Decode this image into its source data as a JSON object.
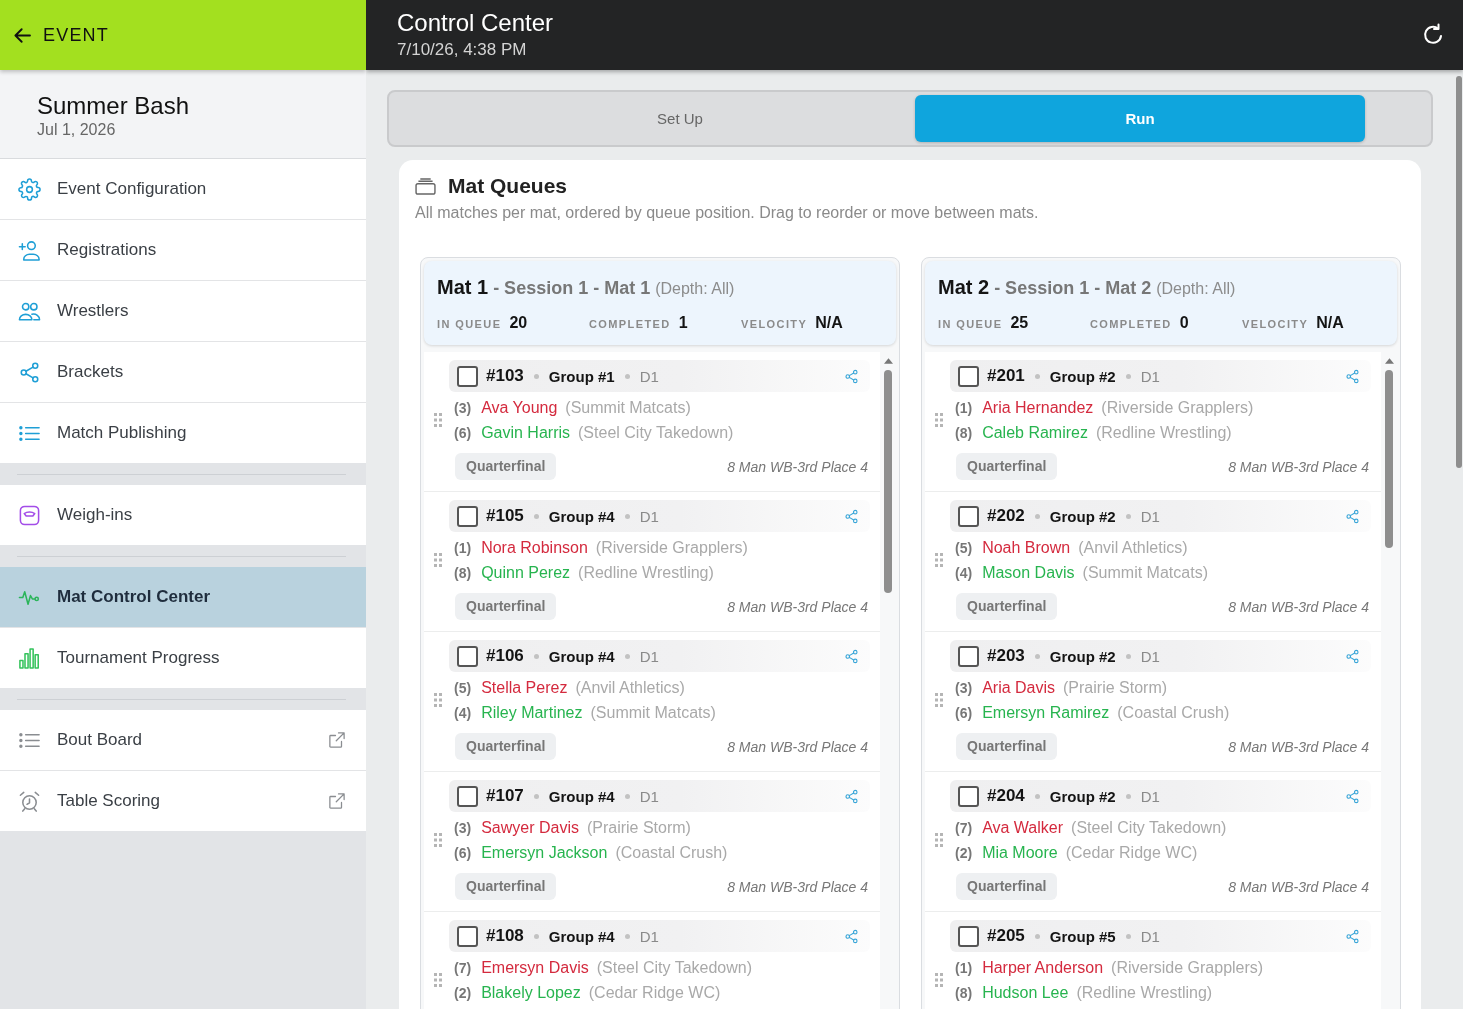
{
  "back_bar": {
    "label": "EVENT"
  },
  "event": {
    "name": "Summer Bash",
    "date": "Jul 1, 2026"
  },
  "nav_groups": [
    {
      "items": [
        {
          "label": "Event Configuration",
          "selected": false,
          "external": false
        },
        {
          "label": "Registrations",
          "selected": false,
          "external": false
        },
        {
          "label": "Wrestlers",
          "selected": false,
          "external": false
        },
        {
          "label": "Brackets",
          "selected": false,
          "external": false
        },
        {
          "label": "Match Publishing",
          "selected": false,
          "external": false
        }
      ]
    },
    {
      "items": [
        {
          "label": "Weigh-ins",
          "selected": false,
          "external": false
        }
      ]
    },
    {
      "items": [
        {
          "label": "Mat Control Center",
          "selected": true,
          "external": false
        },
        {
          "label": "Tournament Progress",
          "selected": false,
          "external": false
        }
      ]
    },
    {
      "items": [
        {
          "label": "Bout Board",
          "selected": false,
          "external": true
        },
        {
          "label": "Table Scoring",
          "selected": false,
          "external": true
        }
      ]
    }
  ],
  "header": {
    "title": "Control Center",
    "timestamp": "7/10/26, 4:38 PM"
  },
  "mode_tabs": [
    {
      "label": "Set Up",
      "selected": false
    },
    {
      "label": "Run",
      "selected": true
    }
  ],
  "panel": {
    "title": "Mat Queues",
    "subtitle": "All matches per mat, ordered by queue position. Drag to reorder or move between mats."
  },
  "mats": [
    {
      "name": "Mat 1",
      "session": "- Session 1 - Mat 1",
      "depth": "(Depth: All)",
      "stats": [
        {
          "label": "IN QUEUE",
          "value": "20"
        },
        {
          "label": "COMPLETED",
          "value": "1"
        },
        {
          "label": "VELOCITY",
          "value": "N/A"
        }
      ],
      "matches": [
        {
          "number": "#103",
          "group": "Group #1",
          "division": "D1",
          "checked": false,
          "wrestlers": [
            {
              "seed": "(3)",
              "name": "Ava Young",
              "team": "(Summit Matcats)",
              "color": "#d42a3e"
            },
            {
              "seed": "(6)",
              "name": "Gavin Harris",
              "team": "(Steel City Takedown)",
              "color": "#27b44f"
            }
          ],
          "round": "Quarterfinal",
          "bracket": "8 Man WB-3rd Place 4"
        },
        {
          "number": "#105",
          "group": "Group #4",
          "division": "D1",
          "checked": false,
          "wrestlers": [
            {
              "seed": "(1)",
              "name": "Nora Robinson",
              "team": "(Riverside Grapplers)",
              "color": "#d42a3e"
            },
            {
              "seed": "(8)",
              "name": "Quinn Perez",
              "team": "(Redline Wrestling)",
              "color": "#27b44f"
            }
          ],
          "round": "Quarterfinal",
          "bracket": "8 Man WB-3rd Place 4"
        },
        {
          "number": "#106",
          "group": "Group #4",
          "division": "D1",
          "checked": false,
          "wrestlers": [
            {
              "seed": "(5)",
              "name": "Stella Perez",
              "team": "(Anvil Athletics)",
              "color": "#d42a3e"
            },
            {
              "seed": "(4)",
              "name": "Riley Martinez",
              "team": "(Summit Matcats)",
              "color": "#27b44f"
            }
          ],
          "round": "Quarterfinal",
          "bracket": "8 Man WB-3rd Place 4"
        },
        {
          "number": "#107",
          "group": "Group #4",
          "division": "D1",
          "checked": false,
          "wrestlers": [
            {
              "seed": "(3)",
              "name": "Sawyer Davis",
              "team": "(Prairie Storm)",
              "color": "#d42a3e"
            },
            {
              "seed": "(6)",
              "name": "Emersyn Jackson",
              "team": "(Coastal Crush)",
              "color": "#27b44f"
            }
          ],
          "round": "Quarterfinal",
          "bracket": "8 Man WB-3rd Place 4"
        },
        {
          "number": "#108",
          "group": "Group #4",
          "division": "D1",
          "checked": false,
          "wrestlers": [
            {
              "seed": "(7)",
              "name": "Emersyn Davis",
              "team": "(Steel City Takedown)",
              "color": "#d42a3e"
            },
            {
              "seed": "(2)",
              "name": "Blakely Lopez",
              "team": "(Cedar Ridge WC)",
              "color": "#27b44f"
            }
          ]
        }
      ]
    },
    {
      "name": "Mat 2",
      "session": "- Session 1 - Mat 2",
      "depth": "(Depth: All)",
      "stats": [
        {
          "label": "IN QUEUE",
          "value": "25"
        },
        {
          "label": "COMPLETED",
          "value": "0"
        },
        {
          "label": "VELOCITY",
          "value": "N/A"
        }
      ],
      "matches": [
        {
          "number": "#201",
          "group": "Group #2",
          "division": "D1",
          "checked": false,
          "wrestlers": [
            {
              "seed": "(1)",
              "name": "Aria Hernandez",
              "team": "(Riverside Grapplers)",
              "color": "#d42a3e"
            },
            {
              "seed": "(8)",
              "name": "Caleb Ramirez",
              "team": "(Redline Wrestling)",
              "color": "#27b44f"
            }
          ],
          "round": "Quarterfinal",
          "bracket": "8 Man WB-3rd Place 4"
        },
        {
          "number": "#202",
          "group": "Group #2",
          "division": "D1",
          "checked": false,
          "wrestlers": [
            {
              "seed": "(5)",
              "name": "Noah Brown",
              "team": "(Anvil Athletics)",
              "color": "#d42a3e"
            },
            {
              "seed": "(4)",
              "name": "Mason Davis",
              "team": "(Summit Matcats)",
              "color": "#27b44f"
            }
          ],
          "round": "Quarterfinal",
          "bracket": "8 Man WB-3rd Place 4"
        },
        {
          "number": "#203",
          "group": "Group #2",
          "division": "D1",
          "checked": false,
          "wrestlers": [
            {
              "seed": "(3)",
              "name": "Aria Davis",
              "team": "(Prairie Storm)",
              "color": "#d42a3e"
            },
            {
              "seed": "(6)",
              "name": "Emersyn Ramirez",
              "team": "(Coastal Crush)",
              "color": "#27b44f"
            }
          ],
          "round": "Quarterfinal",
          "bracket": "8 Man WB-3rd Place 4"
        },
        {
          "number": "#204",
          "group": "Group #2",
          "division": "D1",
          "checked": false,
          "wrestlers": [
            {
              "seed": "(7)",
              "name": "Ava Walker",
              "team": "(Steel City Takedown)",
              "color": "#d42a3e"
            },
            {
              "seed": "(2)",
              "name": "Mia Moore",
              "team": "(Cedar Ridge WC)",
              "color": "#27b44f"
            }
          ],
          "round": "Quarterfinal",
          "bracket": "8 Man WB-3rd Place 4"
        },
        {
          "number": "#205",
          "group": "Group #5",
          "division": "D1",
          "checked": false,
          "wrestlers": [
            {
              "seed": "(1)",
              "name": "Harper Anderson",
              "team": "(Riverside Grapplers)",
              "color": "#d42a3e"
            },
            {
              "seed": "(8)",
              "name": "Hudson Lee",
              "team": "(Redline Wrestling)",
              "color": "#27b44f"
            }
          ]
        }
      ]
    }
  ]
}
